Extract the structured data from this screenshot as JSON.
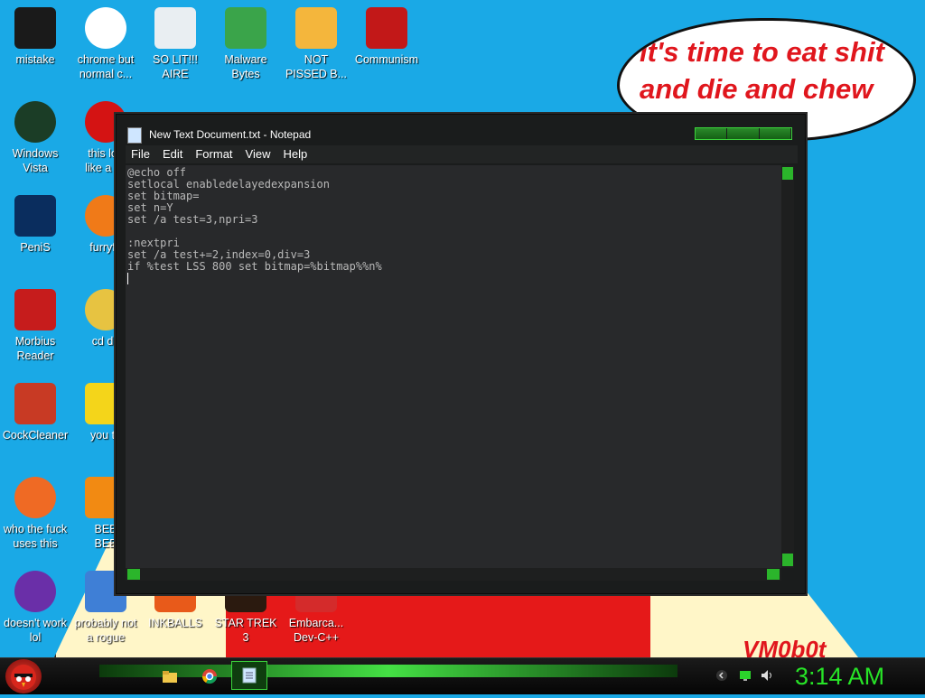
{
  "desktop": {
    "icons": [
      {
        "label": "mistake",
        "icon": "razer-icon",
        "color": "#1a1a1a"
      },
      {
        "label": "chrome but\nnormal c...",
        "icon": "chrome-icon",
        "color": "#ffffff"
      },
      {
        "label": "SO LIT!!!\nAIRE",
        "icon": "solitaire-icon",
        "color": "#e9eef2"
      },
      {
        "label": "Malware\nBytes",
        "icon": "shield-icon",
        "color": "#3aa44a"
      },
      {
        "label": "NOT\nPISSED B...",
        "icon": "bad-piggies-icon",
        "color": "#f4b63c"
      },
      {
        "label": "Communism",
        "icon": "emblem-icon",
        "color": "#c21818"
      },
      {
        "label": "Windows\nVista",
        "icon": "recycle-bin-icon",
        "color": "#1b3d26"
      },
      {
        "label": "this loo\nlike a va",
        "icon": "opera-icon",
        "color": "#d41313"
      },
      {
        "label": "PeniS",
        "icon": "photoshop-icon",
        "color": "#0a2d5e"
      },
      {
        "label": "furryfo",
        "icon": "firefox-icon",
        "color": "#f07a18"
      },
      {
        "label": "Morbius\nReader",
        "icon": "pdf-reader-icon",
        "color": "#c61c1c"
      },
      {
        "label": "cd dri",
        "icon": "cd-icon",
        "color": "#e7c341"
      },
      {
        "label": "CockCleaner",
        "icon": "ccleaner-icon",
        "color": "#c83a24"
      },
      {
        "label": "you tri",
        "icon": "star-icon",
        "color": "#f4d51a"
      },
      {
        "label": "who the fuck\nuses this",
        "icon": "flash-icon",
        "color": "#ef6a24"
      },
      {
        "label": "BEE\nBEE",
        "icon": "vlc-icon",
        "color": "#f28a12"
      },
      {
        "label": "doesn't work\nlol",
        "icon": "yahoo-messenger-icon",
        "color": "#6a2fa8"
      },
      {
        "label": "probably not\na rogue",
        "icon": "computer-icon",
        "color": "#3f7fd6"
      },
      {
        "label": "INKBALLS",
        "icon": "inkball-icon",
        "color": "#e85a1a"
      },
      {
        "label": "STAR TREK\n3",
        "icon": "star-wars-icon",
        "color": "#2b1a0f"
      },
      {
        "label": "Embarca...\nDev-C++",
        "icon": "dev-cpp-icon",
        "color": "#d42b2b"
      }
    ],
    "speech_bubble": "it's time to eat shit and die and chew bubblegum",
    "watermark": "VM0b0t"
  },
  "notepad": {
    "title": "New Text Document.txt - Notepad",
    "menu": [
      "File",
      "Edit",
      "Format",
      "View",
      "Help"
    ],
    "content_lines": [
      "@echo off",
      "setlocal enabledelayedexpansion",
      "set bitmap=",
      "set n=Y",
      "set /a test=3,npri=3",
      "",
      ":nextpri",
      "set /a test+=2,index=0,div=3",
      "if %test LSS 800 set bitmap=%bitmap%%n%"
    ],
    "accent": "#3bd43b"
  },
  "taskbar": {
    "clock": "3:14 AM",
    "pinned": [
      "file-explorer-icon",
      "chrome-icon",
      "notepad-icon"
    ],
    "tray": [
      "chevron-icon",
      "network-icon",
      "volume-icon"
    ]
  }
}
